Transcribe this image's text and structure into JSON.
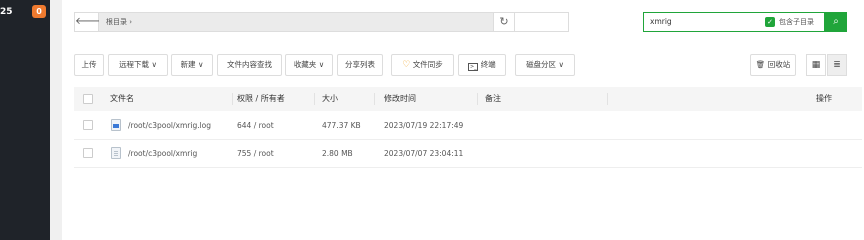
{
  "sidebar": {
    "number": "25",
    "badge": "0"
  },
  "path": {
    "back_icon": "arrow-left-icon",
    "crumb": "根目录 ›",
    "refresh_icon": "refresh-icon"
  },
  "search": {
    "value": "xmrig",
    "include_subdir_label": "包含子目录",
    "search_icon": "magnifier-icon"
  },
  "toolbar": {
    "upload": "上传",
    "remote_download": "远程下载 ∨",
    "new": "新建 ∨",
    "content_search": "文件内容查找",
    "favorites": "收藏夹 ∨",
    "share_list": "分享列表",
    "file_sync": "文件同步",
    "terminal": "终端",
    "disk_partition": "磁盘分区 ∨",
    "recycle_bin": "回收站"
  },
  "table": {
    "columns": [
      "文件名",
      "权限 / 所有者",
      "大小",
      "修改时间",
      "备注",
      "操作"
    ],
    "rows": [
      {
        "name": "/root/c3pool/xmrig.log",
        "perm": "644 / root",
        "size": "477.37 KB",
        "mtime": "2023/07/19 22:17:49",
        "note": ""
      },
      {
        "name": "/root/c3pool/xmrig",
        "perm": "755 / root",
        "size": "2.80 MB",
        "mtime": "2023/07/07 23:04:11",
        "note": ""
      }
    ]
  },
  "colors": {
    "accent": "#20a53a",
    "badge": "#ef7a2f",
    "sidebar": "#1f2329"
  }
}
